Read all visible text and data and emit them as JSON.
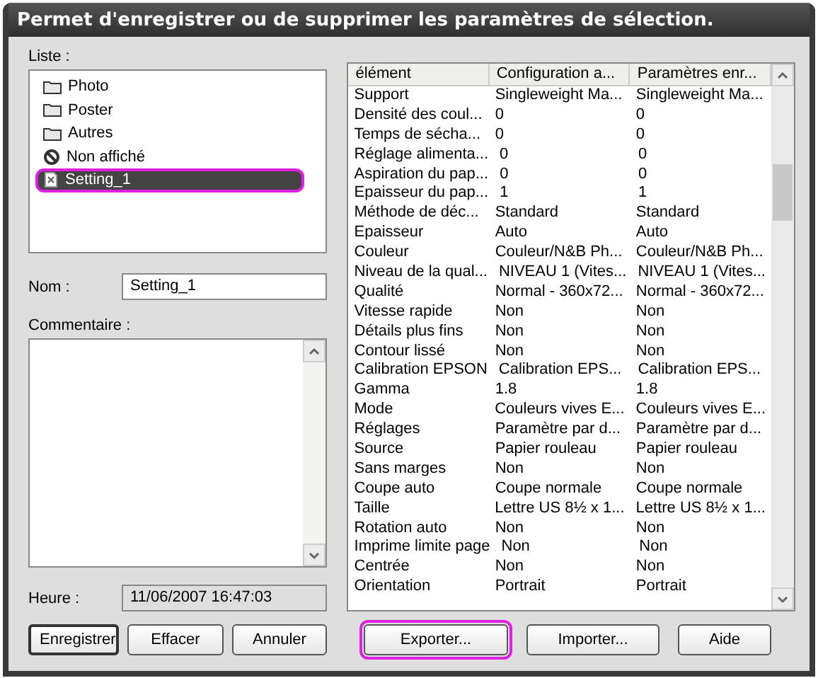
{
  "window": {
    "title": "Permet d'enregistrer ou de supprimer les paramètres de sélection."
  },
  "list": {
    "label": "Liste :",
    "items": [
      {
        "label": "Photo",
        "kind": "folder",
        "selected": false,
        "highlighted": false
      },
      {
        "label": "Poster",
        "kind": "folder",
        "selected": false,
        "highlighted": false
      },
      {
        "label": "Autres",
        "kind": "folder",
        "selected": false,
        "highlighted": false
      },
      {
        "label": "Non affiché",
        "kind": "hidden",
        "selected": false,
        "highlighted": false
      },
      {
        "label": "Setting_1",
        "kind": "setting",
        "selected": true,
        "highlighted": true
      }
    ]
  },
  "name": {
    "label": "Nom :",
    "value": "Setting_1"
  },
  "comment": {
    "label": "Commentaire :"
  },
  "time": {
    "label": "Heure :",
    "value": "11/06/2007 16:47:03"
  },
  "table": {
    "columns": [
      "élément",
      "Configuration a...",
      "Paramètres enr..."
    ],
    "rows": [
      [
        "Support",
        "Singleweight Ma...",
        "Singleweight Ma..."
      ],
      [
        "Densité des coul...",
        "0",
        "0"
      ],
      [
        "Temps de sécha...",
        "0",
        "0"
      ],
      [
        "Réglage alimenta...",
        "0",
        "0"
      ],
      [
        "Aspiration du pap...",
        "0",
        "0"
      ],
      [
        "Epaisseur du pap...",
        "1",
        "1"
      ],
      [
        "Méthode de déc...",
        "Standard",
        "Standard"
      ],
      [
        "Epaisseur",
        "Auto",
        "Auto"
      ],
      [
        "Couleur",
        "Couleur/N&B Ph...",
        "Couleur/N&B Ph..."
      ],
      [
        "Niveau de la qual...",
        "NIVEAU 1 (Vites...",
        "NIVEAU 1 (Vites..."
      ],
      [
        "Qualité",
        "Normal - 360x72...",
        "Normal - 360x72..."
      ],
      [
        "Vitesse rapide",
        "Non",
        "Non"
      ],
      [
        "Détails plus fins",
        "Non",
        "Non"
      ],
      [
        "Contour lissé",
        "Non",
        "Non"
      ],
      [
        "Calibration EPSON",
        "Calibration EPS...",
        "Calibration EPS..."
      ],
      [
        "Gamma",
        "1.8",
        "1.8"
      ],
      [
        "Mode",
        "Couleurs vives E...",
        "Couleurs vives E..."
      ],
      [
        "Réglages",
        "Paramètre par d...",
        "Paramètre par d..."
      ],
      [
        "Source",
        "Papier rouleau",
        "Papier rouleau"
      ],
      [
        "Sans marges",
        "Non",
        "Non"
      ],
      [
        "Coupe auto",
        "Coupe normale",
        "Coupe normale"
      ],
      [
        "Taille",
        "Lettre US 8½ x 1...",
        "Lettre US 8½ x 1..."
      ],
      [
        "Rotation auto",
        "Non",
        "Non"
      ],
      [
        "Imprime limite page",
        "Non",
        "Non"
      ],
      [
        "Centrée",
        "Non",
        "Non"
      ],
      [
        "Orientation",
        "Portrait",
        "Portrait"
      ]
    ]
  },
  "buttons": [
    {
      "label": "Enregistrer",
      "default": true,
      "highlighted": false
    },
    {
      "label": "Effacer",
      "default": false,
      "highlighted": false
    },
    {
      "label": "Annuler",
      "default": false,
      "highlighted": false
    },
    {
      "label": "Exporter...",
      "default": false,
      "highlighted": true
    },
    {
      "label": "Importer...",
      "default": false,
      "highlighted": false
    },
    {
      "label": "Aide",
      "default": false,
      "highlighted": false
    }
  ]
}
